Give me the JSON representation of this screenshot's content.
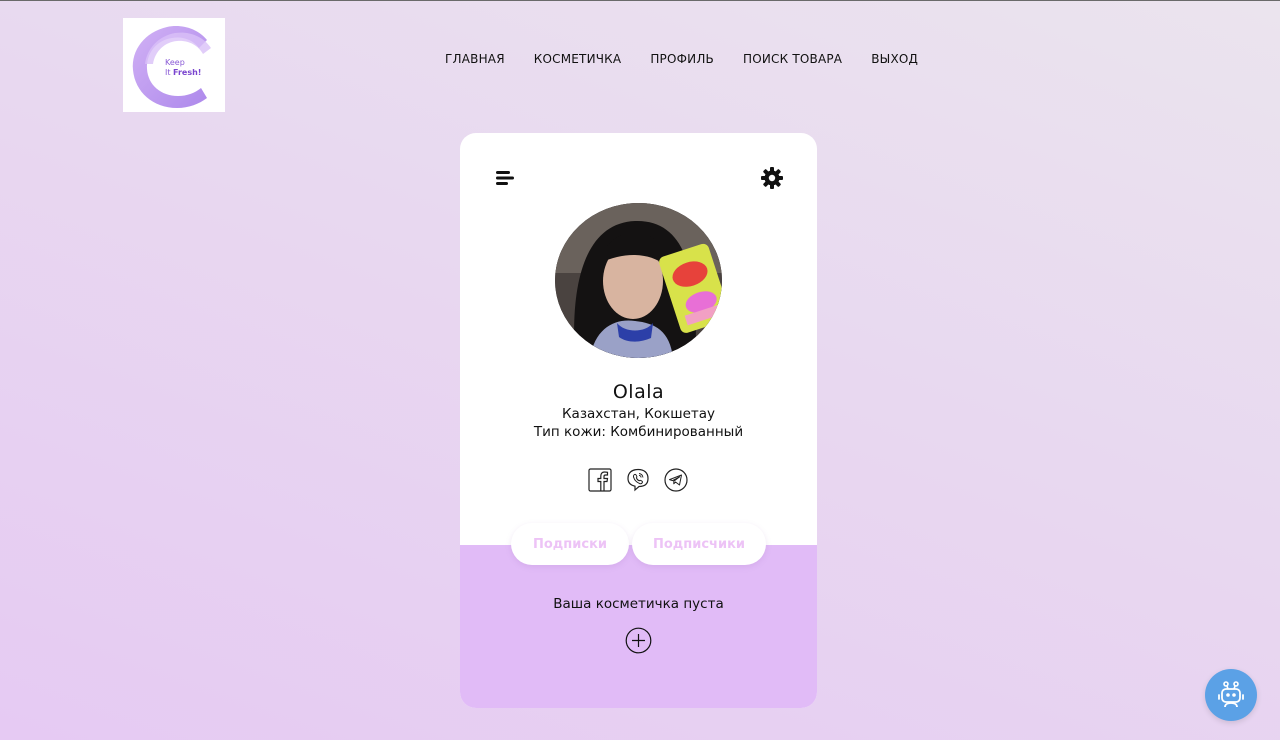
{
  "logo": {
    "line1": "Keep",
    "line2": "It",
    "line3": "Fresh!"
  },
  "nav": [
    {
      "label": "ГЛАВНАЯ"
    },
    {
      "label": "КОСМЕТИЧКА"
    },
    {
      "label": "ПРОФИЛЬ"
    },
    {
      "label": "ПОИСК ТОВАРА"
    },
    {
      "label": "ВЫХОД"
    }
  ],
  "profile": {
    "name": "Olala",
    "location": "Казахстан, Кокшетау",
    "skin_type": "Тип кожи: Комбинированный"
  },
  "socials": [
    "facebook-icon",
    "viber-icon",
    "telegram-icon"
  ],
  "tabs": {
    "subscriptions": "Подписки",
    "subscribers": "Подписчики"
  },
  "bag": {
    "empty_text": "Ваша косметичка пуста"
  },
  "colors": {
    "accent": "#e1bbf7",
    "pill_text": "#edc3f6",
    "bot": "#5ba1e6"
  }
}
